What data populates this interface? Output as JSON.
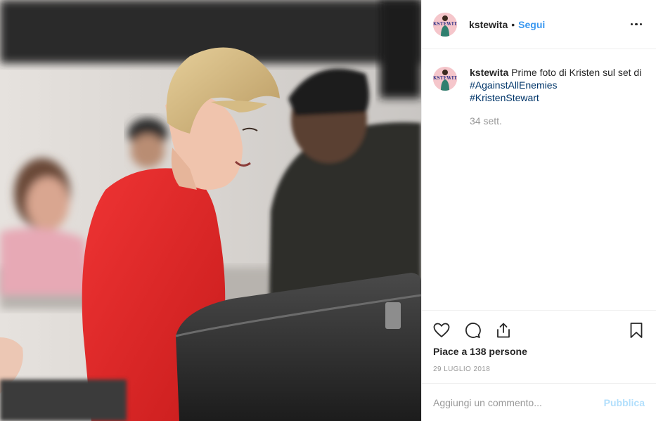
{
  "post": {
    "username": "kstewita",
    "follow_label": "Segui",
    "separator": "•",
    "avatar_text": "KSTEWITA",
    "caption_text": "Prime foto di Kristen sul set di",
    "hashtags": [
      "#AgainstAllEnemies",
      "#KristenStewart"
    ],
    "time_ago": "34 sett.",
    "likes": "Piace a 138 persone",
    "date": "29 LUGLIO 2018"
  },
  "comment": {
    "placeholder": "Aggiungi un commento...",
    "publish_label": "Pubblica"
  },
  "colors": {
    "accent": "#3897f0",
    "hashtag": "#003569",
    "muted": "#999999",
    "publish_disabled": "#b2dffc",
    "red_top": "#e42a2a"
  },
  "icons": [
    "more-options-icon",
    "heart-icon",
    "comment-icon",
    "share-icon",
    "bookmark-icon"
  ]
}
